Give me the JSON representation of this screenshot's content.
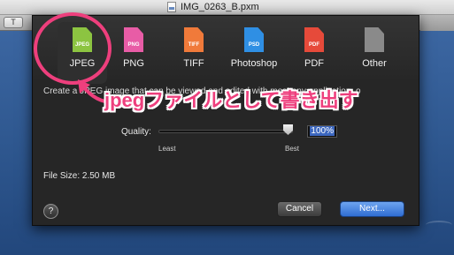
{
  "window": {
    "title": "IMG_0263_B.pxm",
    "toolbar_left_label": "T"
  },
  "formats": [
    {
      "label": "JPEG",
      "ext": "JPEG",
      "color": "#8cc441",
      "selected": true
    },
    {
      "label": "PNG",
      "ext": "PNG",
      "color": "#e85ca6",
      "selected": false
    },
    {
      "label": "TIFF",
      "ext": "TIFF",
      "color": "#f07a3a",
      "selected": false
    },
    {
      "label": "Photoshop",
      "ext": "PSD",
      "color": "#2f8fe4",
      "selected": false
    },
    {
      "label": "PDF",
      "ext": "PDF",
      "color": "#e64a3a",
      "selected": false
    },
    {
      "label": "Other",
      "ext": "",
      "color": "#8a8a8a",
      "selected": false
    }
  ],
  "description": {
    "line1": "Create a JPEG image that can be viewed and edited with most any application, o",
    "line2": "application, o"
  },
  "annotation": {
    "text": "jpegファイルとして書き出す",
    "color": "#ee3f7d"
  },
  "quality": {
    "label": "Quality:",
    "value": "100%",
    "level": 1.0,
    "least": "Least",
    "best": "Best"
  },
  "file_size": "File Size: 2.50 MB",
  "buttons": {
    "help": "?",
    "cancel": "Cancel",
    "next": "Next..."
  }
}
